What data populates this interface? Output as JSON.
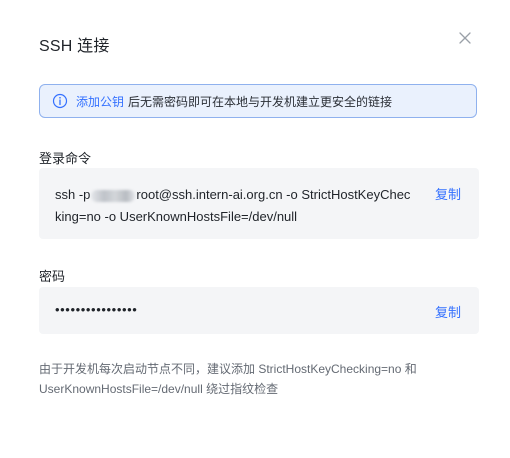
{
  "dialog": {
    "title": "SSH 连接",
    "close_icon": "close-icon"
  },
  "alert": {
    "icon": "info-icon",
    "link_text": "添加公钥",
    "message": "后无需密码即可在本地与开发机建立更安全的链接"
  },
  "login_command": {
    "label": "登录命令",
    "prefix": "ssh -p",
    "line1_rest": "root@ssh.intern-ai.org.cn -o StrictHostKeyChec",
    "line2": "king=no -o UserKnownHostsFile=/dev/null",
    "copy_label": "复制"
  },
  "password": {
    "label": "密码",
    "value": "••••••••••••••••",
    "copy_label": "复制"
  },
  "note": {
    "line1": "由于开发机每次启动节点不同，建议添加 StrictHostKeyChecking=no 和",
    "line2": "UserKnownHostsFile=/dev/null 绕过指纹检查"
  },
  "colors": {
    "accent": "#3370ff",
    "alert_bg": "#eaf1fd",
    "alert_border": "#8fb1ee",
    "box_bg": "#f4f5f7",
    "note_text": "#646a73"
  }
}
